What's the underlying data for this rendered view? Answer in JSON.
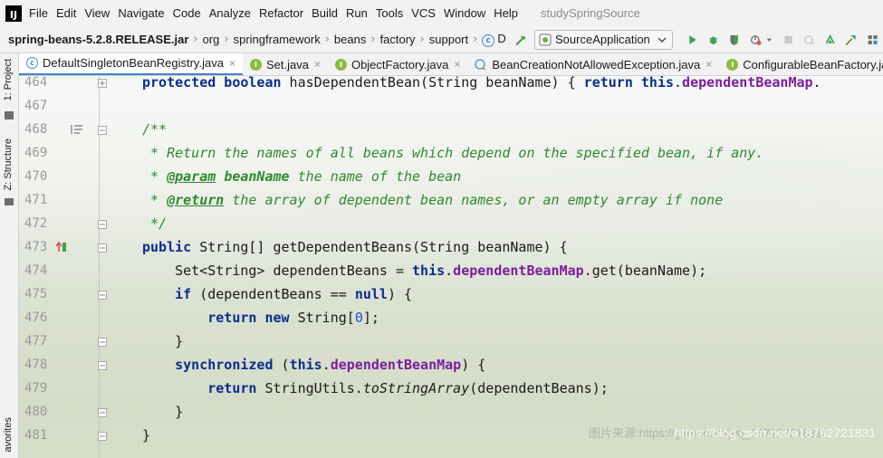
{
  "menubar": {
    "logo": "IJ",
    "items": [
      "File",
      "Edit",
      "View",
      "Navigate",
      "Code",
      "Analyze",
      "Refactor",
      "Build",
      "Run",
      "Tools",
      "VCS",
      "Window",
      "Help"
    ],
    "project_title": "studySpringSource"
  },
  "navbar": {
    "jar": "spring-beans-5.2.8.RELEASE.jar",
    "crumbs": [
      "org",
      "springframework",
      "beans",
      "factory",
      "support"
    ],
    "class_crumb": "D",
    "run_config": "SourceApplication"
  },
  "left_strip": {
    "project": "1: Project",
    "structure": "Z: Structure",
    "favorites": "avorites"
  },
  "tabs": [
    {
      "label": "DefaultSingletonBeanRegistry.java",
      "icon": "class-icon"
    },
    {
      "label": "Set.java",
      "icon": "interface-icon"
    },
    {
      "label": "ObjectFactory.java",
      "icon": "interface-icon"
    },
    {
      "label": "BeanCreationNotAllowedException.java",
      "icon": "exception-class-icon"
    },
    {
      "label": "ConfigurableBeanFactory.jav",
      "icon": "interface-icon"
    }
  ],
  "editor": {
    "line_numbers": [
      "464",
      "467",
      "468",
      "469",
      "470",
      "471",
      "472",
      "473",
      "474",
      "475",
      "476",
      "477",
      "478",
      "479",
      "480",
      "481"
    ],
    "colors": {
      "keyword": "#0a2d8f",
      "field": "#7a1e9e",
      "comment": "#2f8a2f",
      "number": "#1750eb"
    }
  },
  "watermark": {
    "main": "https://blog.csdn.net/a18792721831",
    "secondary": "图片来源:https://gitee.com/jyq_18792721831/"
  }
}
